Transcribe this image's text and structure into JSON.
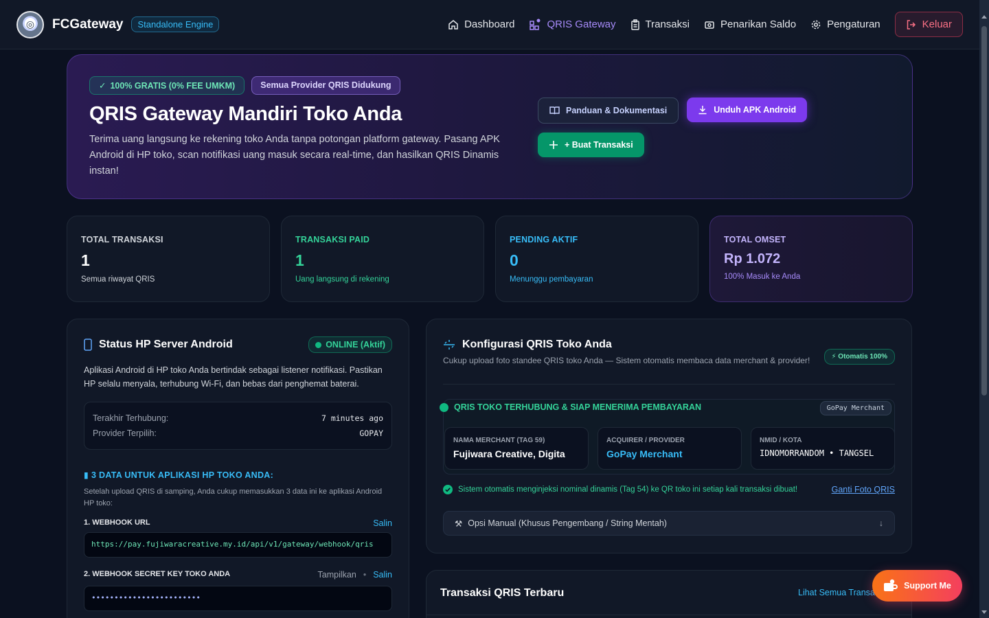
{
  "header": {
    "brand": "FCGateway",
    "engine_badge": "Standalone Engine",
    "nav": [
      {
        "label": "Dashboard",
        "icon": "home-icon"
      },
      {
        "label": "QRIS Gateway",
        "icon": "qr-icon"
      },
      {
        "label": "Transaksi",
        "icon": "clipboard-icon"
      },
      {
        "label": "Penarikan Saldo",
        "icon": "wallet-icon"
      },
      {
        "label": "Pengaturan",
        "icon": "gear-icon"
      }
    ],
    "logout": "Keluar"
  },
  "hero": {
    "badge_free": "100% GRATIS (0% FEE UMKM)",
    "badge_providers": "Semua Provider QRIS Didukung",
    "title": "QRIS Gateway Mandiri Toko Anda",
    "desc": "Terima uang langsung ke rekening toko Anda tanpa potongan platform gateway. Pasang APK Android di HP toko, scan notifikasi uang masuk secara real-time, dan hasilkan QRIS Dinamis instan!",
    "btn_docs": "Panduan & Dokumentasi",
    "btn_apk": "Unduh APK Android",
    "btn_new": "+ Buat Transaksi"
  },
  "stats": [
    {
      "label": "TOTAL TRANSAKSI",
      "value": "1",
      "sub": "Semua riwayat QRIS"
    },
    {
      "label": "TRANSAKSI PAID",
      "value": "1",
      "sub": "Uang langsung di rekening"
    },
    {
      "label": "PENDING AKTIF",
      "value": "0",
      "sub": "Menunggu pembayaran"
    },
    {
      "label": "TOTAL OMSET",
      "value": "Rp 1.072",
      "sub": "100% Masuk ke Anda"
    }
  ],
  "status_panel": {
    "title": "Status HP Server Android",
    "badge": "ONLINE (Aktif)",
    "desc": "Aplikasi Android di HP toko Anda bertindak sebagai listener notifikasi. Pastikan HP selalu menyala, terhubung Wi-Fi, dan bebas dari penghemat baterai.",
    "last_label": "Terakhir Terhubung:",
    "last_value": "7 minutes ago",
    "provider_label": "Provider Terpilih:",
    "provider_value": "GOPAY",
    "data_head": "3 DATA UNTUK APLIKASI HP TOKO ANDA:",
    "data_desc": "Setelah upload QRIS di samping, Anda cukup memasukkan 3 data ini ke aplikasi Android HP toko:",
    "webhook_label": "1. WEBHOOK URL",
    "copy": "Salin",
    "webhook_url": "https://pay.fujiwaracreative.my.id/api/v1/gateway/webhook/qris",
    "secret_label": "2. WEBHOOK SECRET KEY TOKO ANDA",
    "show": "Tampilkan",
    "secret_value": "••••••••••••••••••••••••"
  },
  "config_panel": {
    "title": "Konfigurasi QRIS Toko Anda",
    "sub": "Cukup upload foto standee QRIS toko Anda — Sistem otomatis membaca data merchant & provider!",
    "auto_badge": "⚡ Otomatis 100%",
    "connected": "QRIS TOKO TERHUBUNG & SIAP MENERIMA PEMBAYARAN",
    "provider_tag": "GoPay Merchant",
    "merchant_label": "NAMA MERCHANT (TAG 59)",
    "merchant_value": "Fujiwara Creative, Digita",
    "acquirer_label": "ACQUIRER / PROVIDER",
    "acquirer_value": "GoPay Merchant",
    "nmid_label": "NMID / KOTA",
    "nmid_value": "IDNOMORRANDOM • TANGSEL",
    "inject_text": "Sistem otomatis menginjeksi nominal dinamis (Tag 54) ke QR toko ini setiap kali transaksi dibuat!",
    "change_photo": "Ganti Foto QRIS",
    "manual": "Opsi Manual (Khusus Pengembang / String Mentah)"
  },
  "recent": {
    "title": "Transaksi QRIS Terbaru",
    "see_all": "Lihat Semua Transaksi"
  },
  "support": "Support Me",
  "colors": {
    "accent_purple": "#7c3aed",
    "accent_green": "#10b981",
    "accent_blue": "#38bdf8",
    "danger": "#fb7185"
  }
}
